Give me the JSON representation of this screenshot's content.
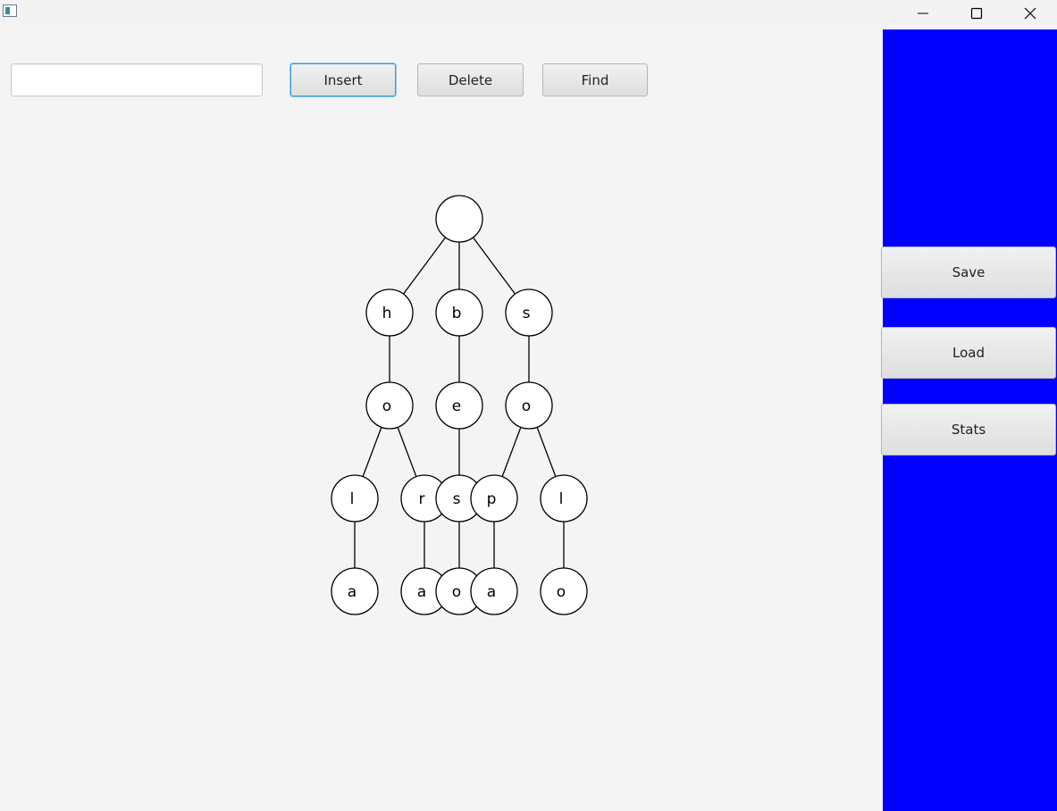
{
  "window": {
    "title": "",
    "icon": "app-window-icon",
    "controls": {
      "minimize_icon": "minimize-icon",
      "maximize_icon": "maximize-icon",
      "close_icon": "close-icon"
    }
  },
  "toolbar": {
    "input_value": "",
    "input_placeholder": "",
    "insert_label": "Insert",
    "delete_label": "Delete",
    "find_label": "Find"
  },
  "side_panel": {
    "background_color": "#0000ff",
    "save_label": "Save",
    "load_label": "Load",
    "stats_label": "Stats"
  },
  "trie": {
    "root": "",
    "nodes": [
      {
        "id": "root",
        "label": ""
      },
      {
        "id": "h",
        "label": "h",
        "parent": "root"
      },
      {
        "id": "b",
        "label": "b",
        "parent": "root"
      },
      {
        "id": "s1",
        "label": "s",
        "parent": "root"
      },
      {
        "id": "ho",
        "label": "o",
        "parent": "h"
      },
      {
        "id": "be",
        "label": "e",
        "parent": "b"
      },
      {
        "id": "so",
        "label": "o",
        "parent": "s1"
      },
      {
        "id": "hol",
        "label": "l",
        "parent": "ho"
      },
      {
        "id": "hor",
        "label": "r",
        "parent": "ho"
      },
      {
        "id": "bes",
        "label": "s",
        "parent": "be"
      },
      {
        "id": "sop",
        "label": "p",
        "parent": "so"
      },
      {
        "id": "sol",
        "label": "l",
        "parent": "so"
      },
      {
        "id": "hola",
        "label": "a",
        "parent": "hol"
      },
      {
        "id": "hora",
        "label": "a",
        "parent": "hor"
      },
      {
        "id": "beso",
        "label": "o",
        "parent": "bes"
      },
      {
        "id": "sopa",
        "label": "a",
        "parent": "sop"
      },
      {
        "id": "solo",
        "label": "o",
        "parent": "sol"
      }
    ]
  }
}
